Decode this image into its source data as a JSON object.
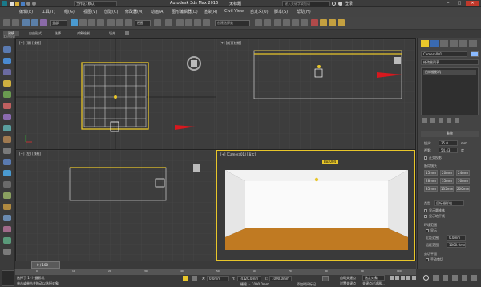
{
  "title_bar": {
    "workspace": "工作区: 默认",
    "app_title": "Autodesk 3ds Max 2016",
    "document_title": "无标题",
    "search_placeholder": "键入关键字或短语",
    "login_label": "登录"
  },
  "menu": {
    "items": [
      "编辑(E)",
      "工具(T)",
      "组(G)",
      "视图(V)",
      "创建(C)",
      "修改器(M)",
      "动画(A)",
      "图形编辑器(D)",
      "渲染(R)",
      "Civil View",
      "自定义(U)",
      "脚本(S)",
      "帮助(H)"
    ]
  },
  "toolbar": {
    "selection_filter": "全部",
    "view_dropdown": "视图",
    "selection_set": "创建选择集"
  },
  "ribbon": {
    "tabs": [
      "建模",
      "自由形式",
      "选择",
      "对象绘制",
      "填充"
    ],
    "sub_label": "多边形建模"
  },
  "viewports": {
    "top_left": {
      "label": "[+] [顶] [线框]"
    },
    "top_right": {
      "label": "[+] [前] [线框]"
    },
    "bottom_left": {
      "label": "[+] [左] [线框]"
    },
    "bottom_right": {
      "label": "[+] [Camera01] [真实]",
      "tag": "Box004"
    }
  },
  "command_panel": {
    "object_name": "Camera001",
    "modifier_list": "修改器列表",
    "stack_item": "目标摄影机",
    "rollout_title": "参数",
    "lens_label": "镜头:",
    "lens_value": "35.0",
    "lens_unit": "mm",
    "fov_label": "视野:",
    "fov_value": "54.43",
    "fov_unit": "度",
    "ortho_label": "正交投影",
    "stock_lens_title": "备用镜头",
    "stock_lenses": [
      "15mm",
      "20mm",
      "24mm",
      "28mm",
      "35mm",
      "50mm",
      "85mm",
      "135mm",
      "200mm"
    ],
    "type_label": "类型",
    "type_value": "目标摄影机",
    "show_cone": "显示圆锥体",
    "show_horizon": "显示地平线",
    "env_range_title": "环境范围",
    "show": "显示",
    "near_range_label": "近距范围:",
    "near_range_value": "0.0mm",
    "far_range_label": "远距范围:",
    "far_range_value": "1000.0mm",
    "clip_title": "剪切平面",
    "manual_clip": "手动剪切"
  },
  "timeline": {
    "frame_display": "0 / 100",
    "ticks": [
      "0",
      "10",
      "20",
      "30",
      "40",
      "50",
      "60",
      "70",
      "80",
      "90",
      "100"
    ]
  },
  "status": {
    "selected_text": "选择了 1 个 摄影机",
    "prompt_text": "单击或单击并拖动以选择对象",
    "x_label": "X:",
    "x_value": "0.0mm",
    "y_label": "Y:",
    "y_value": "-4120.0mm",
    "z_label": "Z:",
    "z_value": "1000.0mm",
    "grid_text": "栅格 = 1000.0mm",
    "auto_key": "自动关键点",
    "set_key": "设置关键点",
    "key_filter": "选定对象",
    "add_time_tag": "添加时间标记",
    "key_filters_label": "关键点过滤器..."
  },
  "colors": {
    "accent": "#e8c62a",
    "red_arrow": "#d8181e",
    "floor": "#c07a22",
    "viewport_bg": "#3d3d3d",
    "active_border": "#e8c62a"
  }
}
